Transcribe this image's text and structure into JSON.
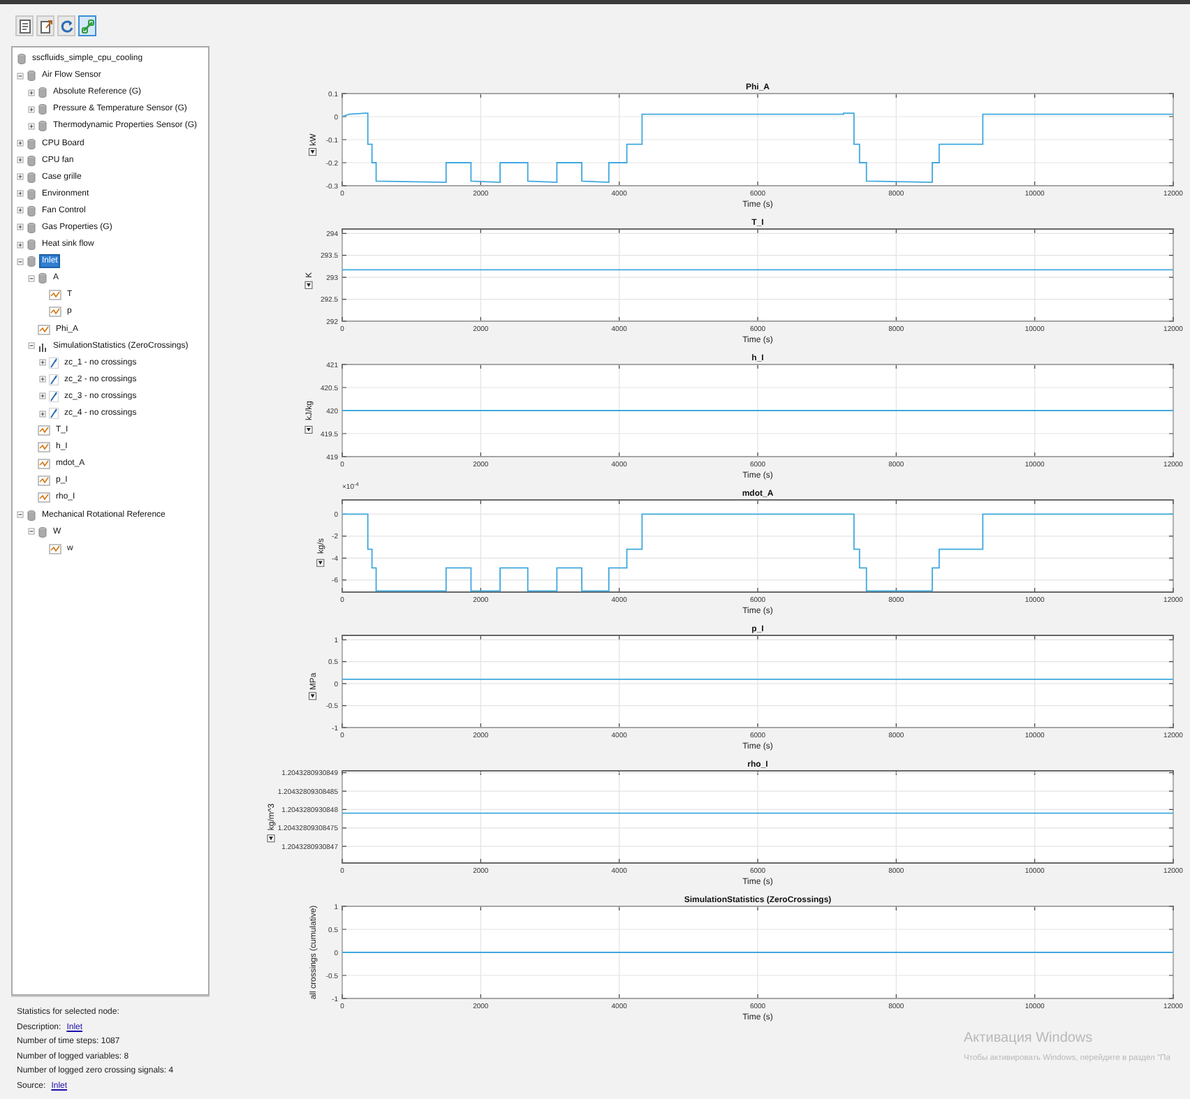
{
  "toolbar": [
    {
      "kind": "properties",
      "selected": false
    },
    {
      "kind": "export",
      "selected": false
    },
    {
      "kind": "refresh",
      "selected": false
    },
    {
      "kind": "link",
      "selected": true
    }
  ],
  "tree": [
    {
      "label": "sscfluids_simple_cpu_cooling",
      "kind": "block",
      "selected": false,
      "children": [
        {
          "label": "Air Flow Sensor",
          "kind": "block",
          "selected": false,
          "expanded": true,
          "children": [
            {
              "label": "Absolute Reference (G)",
              "kind": "block",
              "selected": false,
              "expanded": false
            },
            {
              "label": "Pressure & Temperature Sensor (G)",
              "kind": "block",
              "selected": false,
              "expanded": false
            },
            {
              "label": "Thermodynamic Properties Sensor (G)",
              "kind": "block",
              "selected": false,
              "expanded": false
            }
          ]
        },
        {
          "label": "CPU Board",
          "kind": "block",
          "selected": false,
          "expanded": false
        },
        {
          "label": "CPU fan",
          "kind": "block",
          "selected": false,
          "expanded": false
        },
        {
          "label": "Case grille",
          "kind": "block",
          "selected": false,
          "expanded": false
        },
        {
          "label": "Environment",
          "kind": "block",
          "selected": false,
          "expanded": false
        },
        {
          "label": "Fan Control",
          "kind": "block",
          "selected": false,
          "expanded": false
        },
        {
          "label": "Gas Properties (G)",
          "kind": "block",
          "selected": false,
          "expanded": false
        },
        {
          "label": "Heat sink flow",
          "kind": "block",
          "selected": false,
          "expanded": false
        },
        {
          "label": "Inlet",
          "kind": "block",
          "selected": true,
          "expanded": true,
          "children": [
            {
              "label": "A",
              "kind": "block",
              "selected": false,
              "expanded": true,
              "children": [
                {
                  "label": "T",
                  "kind": "signal",
                  "selected": false
                },
                {
                  "label": "p",
                  "kind": "signal",
                  "selected": false
                }
              ]
            },
            {
              "label": "Phi_A",
              "kind": "signal",
              "selected": false
            },
            {
              "label": "SimulationStatistics (ZeroCrossings)",
              "kind": "statistics",
              "selected": false,
              "expanded": true,
              "children": [
                {
                  "label": "zc_1 - no crossings",
                  "kind": "crossing",
                  "selected": false,
                  "expanded": false
                },
                {
                  "label": "zc_2 - no crossings",
                  "kind": "crossing",
                  "selected": false,
                  "expanded": false
                },
                {
                  "label": "zc_3 - no crossings",
                  "kind": "crossing",
                  "selected": false,
                  "expanded": false
                },
                {
                  "label": "zc_4 - no crossings",
                  "kind": "crossing",
                  "selected": false,
                  "expanded": false
                }
              ]
            },
            {
              "label": "T_I",
              "kind": "signal",
              "selected": false
            },
            {
              "label": "h_I",
              "kind": "signal",
              "selected": false
            },
            {
              "label": "mdot_A",
              "kind": "signal",
              "selected": false
            },
            {
              "label": "p_I",
              "kind": "signal",
              "selected": false
            },
            {
              "label": "rho_I",
              "kind": "signal",
              "selected": false
            }
          ]
        },
        {
          "label": "Mechanical Rotational Reference",
          "kind": "block",
          "selected": false,
          "expanded": true,
          "children": [
            {
              "label": "W",
              "kind": "block",
              "selected": false,
              "expanded": true,
              "children": [
                {
                  "label": "w",
                  "kind": "signal",
                  "selected": false
                }
              ]
            }
          ]
        }
      ]
    }
  ],
  "statistics": [
    {
      "text": "Statistics for selected node:"
    },
    {
      "text": "Description:",
      "link": "Inlet"
    },
    {
      "text": "Number of time steps: 1087"
    },
    {
      "text": "Number of logged variables: 8"
    },
    {
      "text": "Number of logged zero crossing signals: 4"
    },
    {
      "text": "Source:",
      "link": "Inlet"
    }
  ],
  "plots": [
    {
      "ylabel_dropdown": true,
      "chart_data": {
        "type": "line",
        "title": "Phi_A",
        "xlabel": "Time (s)",
        "ylabel": "kW",
        "grid": true,
        "xlim": [
          0,
          12000
        ],
        "ylim": [
          -0.3,
          0.1
        ],
        "xticks": [
          0,
          2000,
          4000,
          6000,
          8000,
          10000,
          12000
        ],
        "yticks": [
          -0.3,
          -0.2,
          -0.1,
          0,
          0.1
        ],
        "x": [
          0,
          100,
          330,
          370,
          370,
          430,
          430,
          490,
          490,
          1500,
          1500,
          1860,
          1860,
          2280,
          2280,
          2680,
          2680,
          3100,
          3100,
          3460,
          3460,
          3850,
          3850,
          4110,
          4110,
          4330,
          4330,
          7240,
          7240,
          7390,
          7390,
          7470,
          7470,
          7570,
          7570,
          8520,
          8520,
          8620,
          8620,
          9250,
          9250,
          12000
        ],
        "series": [
          {
            "color": "#3ea8de",
            "values": [
              0,
              0.01,
              0.015,
              0.015,
              -0.12,
              -0.12,
              -0.2,
              -0.2,
              -0.28,
              -0.285,
              -0.2,
              -0.2,
              -0.28,
              -0.285,
              -0.2,
              -0.2,
              -0.28,
              -0.285,
              -0.2,
              -0.2,
              -0.28,
              -0.285,
              -0.2,
              -0.2,
              -0.12,
              -0.12,
              0.01,
              0.01,
              0.015,
              0.015,
              -0.12,
              -0.12,
              -0.2,
              -0.2,
              -0.28,
              -0.285,
              -0.2,
              -0.2,
              -0.12,
              -0.12,
              0.01,
              0.01
            ]
          }
        ]
      }
    },
    {
      "ylabel_dropdown": true,
      "chart_data": {
        "type": "line",
        "title": "T_I",
        "xlabel": "Time (s)",
        "ylabel": "K",
        "grid": true,
        "xlim": [
          0,
          12000
        ],
        "ylim": [
          292,
          294.1
        ],
        "xticks": [
          0,
          2000,
          4000,
          6000,
          8000,
          10000,
          12000
        ],
        "yticks": [
          292,
          292.5,
          293,
          293.5,
          294
        ],
        "x": [
          0,
          12000
        ],
        "series": [
          {
            "color": "#3ea8de",
            "values": [
              293.17,
              293.17
            ]
          }
        ]
      }
    },
    {
      "ylabel_dropdown": true,
      "chart_data": {
        "type": "line",
        "title": "h_I",
        "xlabel": "Time (s)",
        "ylabel": "kJ/kg",
        "grid": true,
        "xlim": [
          0,
          12000
        ],
        "ylim": [
          419,
          421
        ],
        "xticks": [
          0,
          2000,
          4000,
          6000,
          8000,
          10000,
          12000
        ],
        "yticks": [
          419,
          419.5,
          420,
          420.5,
          421
        ],
        "x": [
          0,
          12000
        ],
        "series": [
          {
            "color": "#3ea8de",
            "values": [
              420,
              420
            ]
          }
        ]
      }
    },
    {
      "ylabel_dropdown": true,
      "chart_data": {
        "type": "line",
        "title": "mdot_A",
        "xlabel": "Time (s)",
        "ylabel": "kg/s",
        "grid": true,
        "xlim": [
          0,
          12000
        ],
        "ylim": [
          -7.1,
          1.3
        ],
        "xticks": [
          0,
          2000,
          4000,
          6000,
          8000,
          10000,
          12000
        ],
        "yticks": [
          -6,
          -4,
          -2,
          0
        ],
        "annotations": [
          {
            "text": "×10$^{-4}$"
          }
        ],
        "x": [
          0,
          100,
          330,
          370,
          370,
          430,
          430,
          490,
          490,
          1500,
          1500,
          1860,
          1860,
          2280,
          2280,
          2680,
          2680,
          3100,
          3100,
          3460,
          3460,
          3850,
          3850,
          4110,
          4110,
          4330,
          4330,
          7240,
          7240,
          7390,
          7390,
          7470,
          7470,
          7570,
          7570,
          8520,
          8520,
          8620,
          8620,
          9250,
          9250,
          12000
        ],
        "series": [
          {
            "color": "#3ea8de",
            "values": [
              0,
              0,
              0,
              0,
              -3.2,
              -3.2,
              -4.9,
              -4.9,
              -7,
              -7,
              -4.9,
              -4.9,
              -7,
              -7,
              -4.9,
              -4.9,
              -7,
              -7,
              -4.9,
              -4.9,
              -7,
              -7,
              -4.9,
              -4.9,
              -3.2,
              -3.2,
              0,
              0,
              0,
              0,
              -3.2,
              -3.2,
              -4.9,
              -4.9,
              -7,
              -7,
              -4.9,
              -4.9,
              -3.2,
              -3.2,
              0,
              0
            ]
          }
        ]
      }
    },
    {
      "ylabel_dropdown": true,
      "chart_data": {
        "type": "line",
        "title": "p_I",
        "xlabel": "Time (s)",
        "ylabel": "MPa",
        "grid": true,
        "xlim": [
          0,
          12000
        ],
        "ylim": [
          -1,
          1.1
        ],
        "xticks": [
          0,
          2000,
          4000,
          6000,
          8000,
          10000,
          12000
        ],
        "yticks": [
          -1,
          -0.5,
          0,
          0.5,
          1
        ],
        "x": [
          0,
          12000
        ],
        "series": [
          {
            "color": "#3ea8de",
            "values": [
              0.1,
              0.1
            ]
          }
        ]
      }
    },
    {
      "ylabel_dropdown": true,
      "chart_data": {
        "type": "line",
        "title": "rho_I",
        "xlabel": "Time (s)",
        "ylabel": "kg/m^3",
        "grid": true,
        "xlim": [
          0,
          12000
        ],
        "ylim": [
          1.204328093084655,
          1.204328093084905
        ],
        "xticks": [
          0,
          2000,
          4000,
          6000,
          8000,
          10000,
          12000
        ],
        "yticks": [
          {
            "value": 1.2043280930847,
            "label": "1.2043280930847"
          },
          {
            "value": 1.20432809308475,
            "label": "1.20432809308475"
          },
          {
            "value": 1.2043280930848,
            "label": "1.2043280930848"
          },
          {
            "value": 1.20432809308485,
            "label": "1.20432809308485"
          },
          {
            "value": 1.2043280930849,
            "label": "1.2043280930849"
          }
        ],
        "x": [
          0,
          12000
        ],
        "series": [
          {
            "color": "#3ea8de",
            "values": [
              1.20432809308479,
              1.20432809308479
            ]
          }
        ]
      }
    },
    {
      "ylabel_dropdown": false,
      "chart_data": {
        "type": "line",
        "title": "SimulationStatistics (ZeroCrossings)",
        "xlabel": "Time (s)",
        "ylabel": "all crossings (cumulative)",
        "grid": true,
        "xlim": [
          0,
          12000
        ],
        "ylim": [
          -1,
          1
        ],
        "xticks": [
          0,
          2000,
          4000,
          6000,
          8000,
          10000,
          12000
        ],
        "yticks": [
          -1,
          -0.5,
          0,
          0.5,
          1
        ],
        "x": [
          0,
          12000
        ],
        "series": [
          {
            "color": "#3ea8de",
            "values": [
              0,
              0
            ]
          }
        ]
      }
    }
  ],
  "os_notice": {
    "title": "Активация Windows",
    "text": "Чтобы активировать Windows, перейдите в раздел \"Па"
  }
}
